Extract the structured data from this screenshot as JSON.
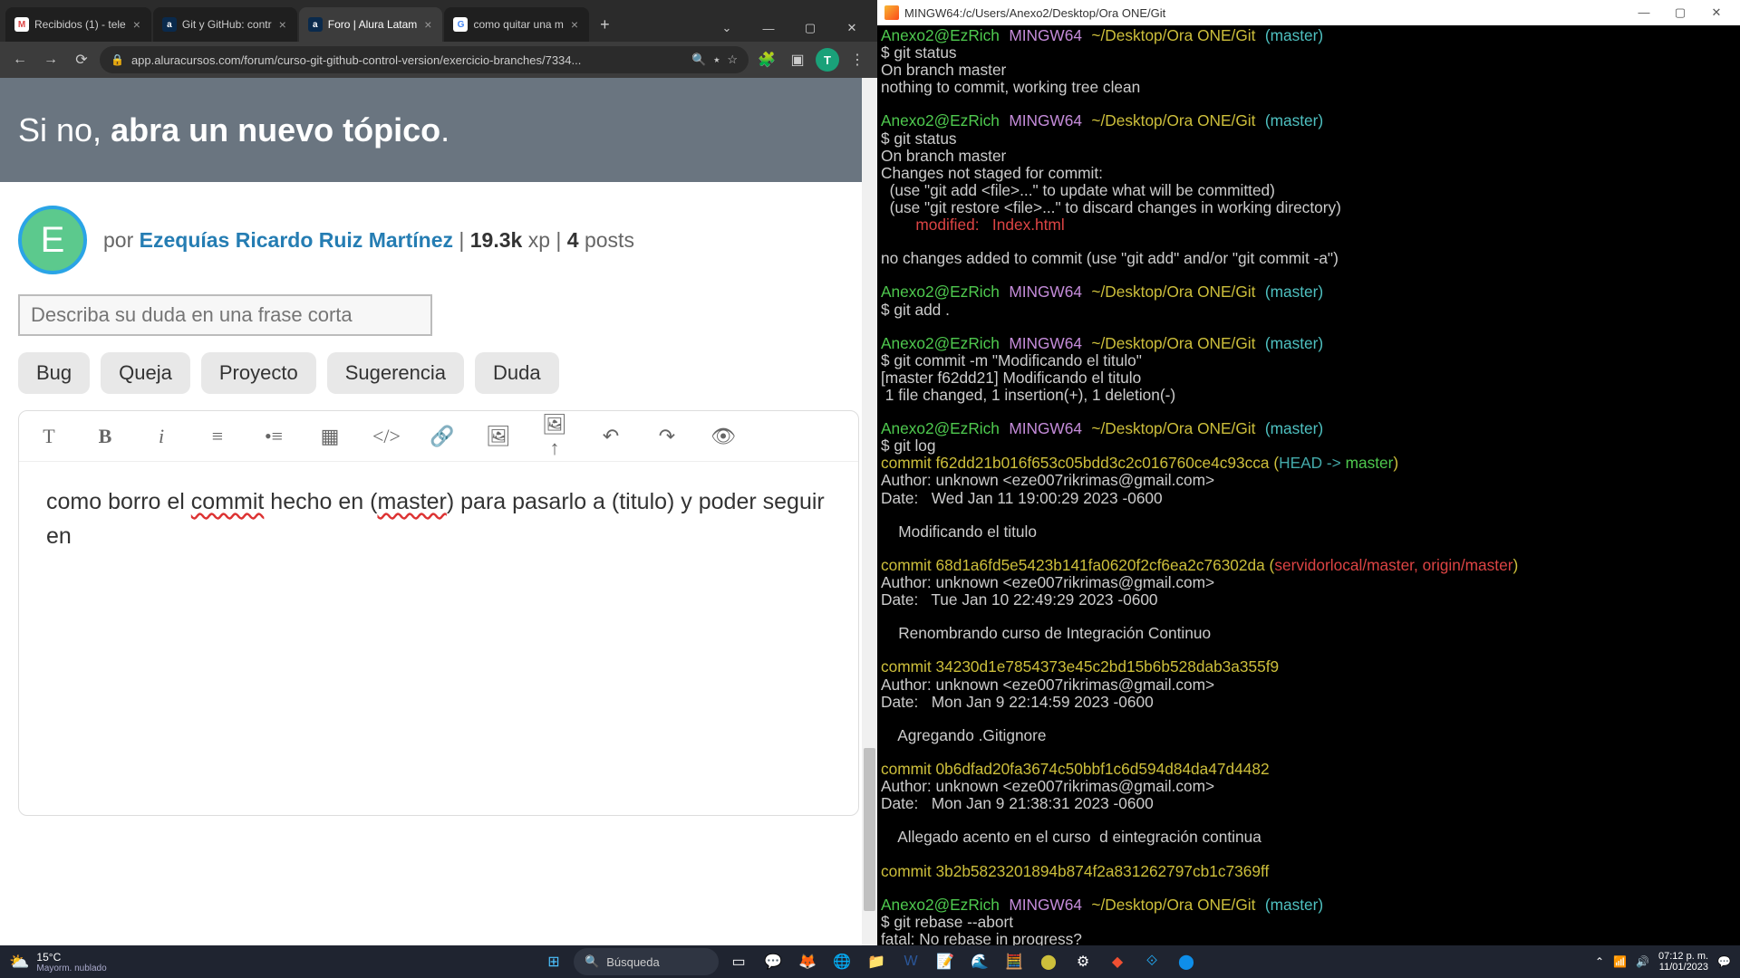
{
  "browser": {
    "tabs": [
      {
        "favBg": "#fff",
        "favTxt": "M",
        "favColor": "#d44",
        "title": "Recibidos (1) - tele"
      },
      {
        "favBg": "#0a2a4c",
        "favTxt": "a",
        "favColor": "#fff",
        "title": "Git y GitHub: contr"
      },
      {
        "favBg": "#0a2a4c",
        "favTxt": "a",
        "favColor": "#fff",
        "title": "Foro | Alura Latam",
        "active": true
      },
      {
        "favBg": "#fff",
        "favTxt": "G",
        "favColor": "#4285f4",
        "title": "como quitar una m"
      }
    ],
    "url": "app.aluracursos.com/forum/curso-git-github-control-version/exercicio-branches/7334...",
    "profileLetter": "T"
  },
  "page": {
    "banner_pre": "Si no, ",
    "banner_bold": "abra un nuevo tópico",
    "banner_post": ".",
    "avatarLetter": "E",
    "by": "por ",
    "author": "Ezequías Ricardo Ruiz Martínez",
    "xp_num": "19.3k",
    "xp_lbl": " xp",
    "posts_num": "4",
    "posts_lbl": " posts",
    "title_placeholder": "Describa su duda en una frase corta",
    "tags": [
      "Bug",
      "Queja",
      "Proyecto",
      "Sugerencia",
      "Duda"
    ],
    "body_p1": "como borro el ",
    "body_u1": "commit",
    "body_p2": " hecho en (",
    "body_u2": "master",
    "body_p3": ") para pasarlo a (titulo) y poder seguir en"
  },
  "terminal": {
    "title": "MINGW64:/c/Users/Anexo2/Desktop/Ora ONE/Git",
    "prompt_user": "Anexo2@EzRich",
    "prompt_host": "MINGW64",
    "prompt_path": "~/Desktop/Ora ONE/Git",
    "prompt_branch": "(master)",
    "cmd1": "$ git status",
    "out1a": "On branch master",
    "out1b": "nothing to commit, working tree clean",
    "cmd2": "$ git status",
    "out2a": "On branch master",
    "out2b": "Changes not staged for commit:",
    "out2c": "  (use \"git add <file>...\" to update what will be committed)",
    "out2d": "  (use \"git restore <file>...\" to discard changes in working directory)",
    "out2e": "        modified:   Index.html",
    "out2f": "no changes added to commit (use \"git add\" and/or \"git commit -a\")",
    "cmd3": "$ git add .",
    "cmd4": "$ git commit -m \"Modificando el titulo\"",
    "out4a": "[master f62dd21] Modificando el titulo",
    "out4b": " 1 file changed, 1 insertion(+), 1 deletion(-)",
    "cmd5": "$ git log",
    "c1_hash": "commit f62dd21b016f653c05bdd3c2c016760ce4c93cca ",
    "c1_head": "(",
    "c1_head2": "HEAD -> ",
    "c1_head3": "master",
    "c1_head4": ")",
    "c1_auth": "Author: unknown <eze007rikrimas@gmail.com>",
    "c1_date": "Date:   Wed Jan 11 19:00:29 2023 -0600",
    "c1_msg": "    Modificando el titulo",
    "c2_hash": "commit 68d1a6fd5e5423b141fa0620f2cf6ea2c76302da ",
    "c2_ref": "(",
    "c2_ref2": "servidorlocal/master, origin/master",
    "c2_ref3": ")",
    "c2_auth": "Author: unknown <eze007rikrimas@gmail.com>",
    "c2_date": "Date:   Tue Jan 10 22:49:29 2023 -0600",
    "c2_msg": "    Renombrando curso de Integración Continuo",
    "c3_hash": "commit 34230d1e7854373e45c2bd15b6b528dab3a355f9",
    "c3_auth": "Author: unknown <eze007rikrimas@gmail.com>",
    "c3_date": "Date:   Mon Jan 9 22:14:59 2023 -0600",
    "c3_msg": "    Agregando .Gitignore",
    "c4_hash": "commit 0b6dfad20fa3674c50bbf1c6d594d84da47d4482",
    "c4_auth": "Author: unknown <eze007rikrimas@gmail.com>",
    "c4_date": "Date:   Mon Jan 9 21:38:31 2023 -0600",
    "c4_msg": "    Allegado acento en el curso  d eintegración continua",
    "c5_hash": "commit 3b2b5823201894b874f2a831262797cb1c7369ff",
    "cmd6": "$ git rebase --abort",
    "out6": "fatal: No rebase in progress?"
  },
  "taskbar": {
    "temp": "15°C",
    "weather": "Mayorm. nublado",
    "search": "Búsqueda",
    "time": "07:12 p. m.",
    "date": "11/01/2023"
  }
}
